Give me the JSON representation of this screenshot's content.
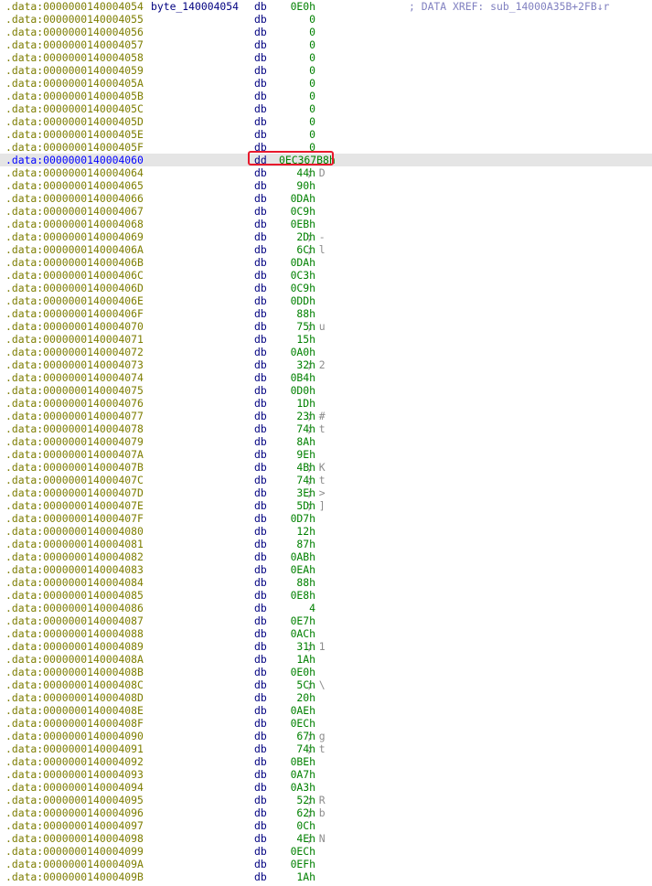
{
  "segment": ".data",
  "label": "byte_140004054",
  "xref_comment": "; DATA XREF: sub_14000A35B+2FB↓r",
  "colors": {
    "address": "#7d7d00",
    "address_selected": "#0000ff",
    "directive": "#000080",
    "value": "#008000",
    "comment": "#8c8c8c",
    "xref": "#8080c0",
    "selection_bg": "#e5e5e5",
    "highlight_box": "#e8192c"
  },
  "highlighted_line_index": 12,
  "lines": [
    {
      "addr": ".data:0000000140004054",
      "dir": "db",
      "val": "0E0h"
    },
    {
      "addr": ".data:0000000140004055",
      "dir": "db",
      "val": "0"
    },
    {
      "addr": ".data:0000000140004056",
      "dir": "db",
      "val": "0"
    },
    {
      "addr": ".data:0000000140004057",
      "dir": "db",
      "val": "0"
    },
    {
      "addr": ".data:0000000140004058",
      "dir": "db",
      "val": "0"
    },
    {
      "addr": ".data:0000000140004059",
      "dir": "db",
      "val": "0"
    },
    {
      "addr": ".data:000000014000405A",
      "dir": "db",
      "val": "0"
    },
    {
      "addr": ".data:000000014000405B",
      "dir": "db",
      "val": "0"
    },
    {
      "addr": ".data:000000014000405C",
      "dir": "db",
      "val": "0"
    },
    {
      "addr": ".data:000000014000405D",
      "dir": "db",
      "val": "0"
    },
    {
      "addr": ".data:000000014000405E",
      "dir": "db",
      "val": "0"
    },
    {
      "addr": ".data:000000014000405F",
      "dir": "db",
      "val": "0"
    },
    {
      "addr": ".data:0000000140004060",
      "dir": "dd",
      "val": "0EC367B8h"
    },
    {
      "addr": ".data:0000000140004064",
      "dir": "db",
      "val": "44h",
      "cmt": "; D"
    },
    {
      "addr": ".data:0000000140004065",
      "dir": "db",
      "val": "90h"
    },
    {
      "addr": ".data:0000000140004066",
      "dir": "db",
      "val": "0DAh"
    },
    {
      "addr": ".data:0000000140004067",
      "dir": "db",
      "val": "0C9h"
    },
    {
      "addr": ".data:0000000140004068",
      "dir": "db",
      "val": "0EBh"
    },
    {
      "addr": ".data:0000000140004069",
      "dir": "db",
      "val": "2Dh",
      "cmt": "; -"
    },
    {
      "addr": ".data:000000014000406A",
      "dir": "db",
      "val": "6Ch",
      "cmt": "; l"
    },
    {
      "addr": ".data:000000014000406B",
      "dir": "db",
      "val": "0DAh"
    },
    {
      "addr": ".data:000000014000406C",
      "dir": "db",
      "val": "0C3h"
    },
    {
      "addr": ".data:000000014000406D",
      "dir": "db",
      "val": "0C9h"
    },
    {
      "addr": ".data:000000014000406E",
      "dir": "db",
      "val": "0DDh"
    },
    {
      "addr": ".data:000000014000406F",
      "dir": "db",
      "val": "88h"
    },
    {
      "addr": ".data:0000000140004070",
      "dir": "db",
      "val": "75h",
      "cmt": "; u"
    },
    {
      "addr": ".data:0000000140004071",
      "dir": "db",
      "val": "15h"
    },
    {
      "addr": ".data:0000000140004072",
      "dir": "db",
      "val": "0A0h"
    },
    {
      "addr": ".data:0000000140004073",
      "dir": "db",
      "val": "32h",
      "cmt": "; 2"
    },
    {
      "addr": ".data:0000000140004074",
      "dir": "db",
      "val": "0B4h"
    },
    {
      "addr": ".data:0000000140004075",
      "dir": "db",
      "val": "0D0h"
    },
    {
      "addr": ".data:0000000140004076",
      "dir": "db",
      "val": "1Dh"
    },
    {
      "addr": ".data:0000000140004077",
      "dir": "db",
      "val": "23h",
      "cmt": "; #"
    },
    {
      "addr": ".data:0000000140004078",
      "dir": "db",
      "val": "74h",
      "cmt": "; t"
    },
    {
      "addr": ".data:0000000140004079",
      "dir": "db",
      "val": "8Ah"
    },
    {
      "addr": ".data:000000014000407A",
      "dir": "db",
      "val": "9Eh"
    },
    {
      "addr": ".data:000000014000407B",
      "dir": "db",
      "val": "4Bh",
      "cmt": "; K"
    },
    {
      "addr": ".data:000000014000407C",
      "dir": "db",
      "val": "74h",
      "cmt": "; t"
    },
    {
      "addr": ".data:000000014000407D",
      "dir": "db",
      "val": "3Eh",
      "cmt": "; >"
    },
    {
      "addr": ".data:000000014000407E",
      "dir": "db",
      "val": "5Dh",
      "cmt": "; ]"
    },
    {
      "addr": ".data:000000014000407F",
      "dir": "db",
      "val": "0D7h"
    },
    {
      "addr": ".data:0000000140004080",
      "dir": "db",
      "val": "12h"
    },
    {
      "addr": ".data:0000000140004081",
      "dir": "db",
      "val": "87h"
    },
    {
      "addr": ".data:0000000140004082",
      "dir": "db",
      "val": "0ABh"
    },
    {
      "addr": ".data:0000000140004083",
      "dir": "db",
      "val": "0EAh"
    },
    {
      "addr": ".data:0000000140004084",
      "dir": "db",
      "val": "88h"
    },
    {
      "addr": ".data:0000000140004085",
      "dir": "db",
      "val": "0E8h"
    },
    {
      "addr": ".data:0000000140004086",
      "dir": "db",
      "val": "4"
    },
    {
      "addr": ".data:0000000140004087",
      "dir": "db",
      "val": "0E7h"
    },
    {
      "addr": ".data:0000000140004088",
      "dir": "db",
      "val": "0ACh"
    },
    {
      "addr": ".data:0000000140004089",
      "dir": "db",
      "val": "31h",
      "cmt": "; 1"
    },
    {
      "addr": ".data:000000014000408A",
      "dir": "db",
      "val": "1Ah"
    },
    {
      "addr": ".data:000000014000408B",
      "dir": "db",
      "val": "0E0h"
    },
    {
      "addr": ".data:000000014000408C",
      "dir": "db",
      "val": "5Ch",
      "cmt": "; \\"
    },
    {
      "addr": ".data:000000014000408D",
      "dir": "db",
      "val": "20h"
    },
    {
      "addr": ".data:000000014000408E",
      "dir": "db",
      "val": "0AEh"
    },
    {
      "addr": ".data:000000014000408F",
      "dir": "db",
      "val": "0ECh"
    },
    {
      "addr": ".data:0000000140004090",
      "dir": "db",
      "val": "67h",
      "cmt": "; g"
    },
    {
      "addr": ".data:0000000140004091",
      "dir": "db",
      "val": "74h",
      "cmt": "; t"
    },
    {
      "addr": ".data:0000000140004092",
      "dir": "db",
      "val": "0BEh"
    },
    {
      "addr": ".data:0000000140004093",
      "dir": "db",
      "val": "0A7h"
    },
    {
      "addr": ".data:0000000140004094",
      "dir": "db",
      "val": "0A3h"
    },
    {
      "addr": ".data:0000000140004095",
      "dir": "db",
      "val": "52h",
      "cmt": "; R"
    },
    {
      "addr": ".data:0000000140004096",
      "dir": "db",
      "val": "62h",
      "cmt": "; b"
    },
    {
      "addr": ".data:0000000140004097",
      "dir": "db",
      "val": "0Ch"
    },
    {
      "addr": ".data:0000000140004098",
      "dir": "db",
      "val": "4Eh",
      "cmt": "; N"
    },
    {
      "addr": ".data:0000000140004099",
      "dir": "db",
      "val": "0ECh"
    },
    {
      "addr": ".data:000000014000409A",
      "dir": "db",
      "val": "0EFh"
    },
    {
      "addr": ".data:000000014000409B",
      "dir": "db",
      "val": "1Ah"
    }
  ]
}
